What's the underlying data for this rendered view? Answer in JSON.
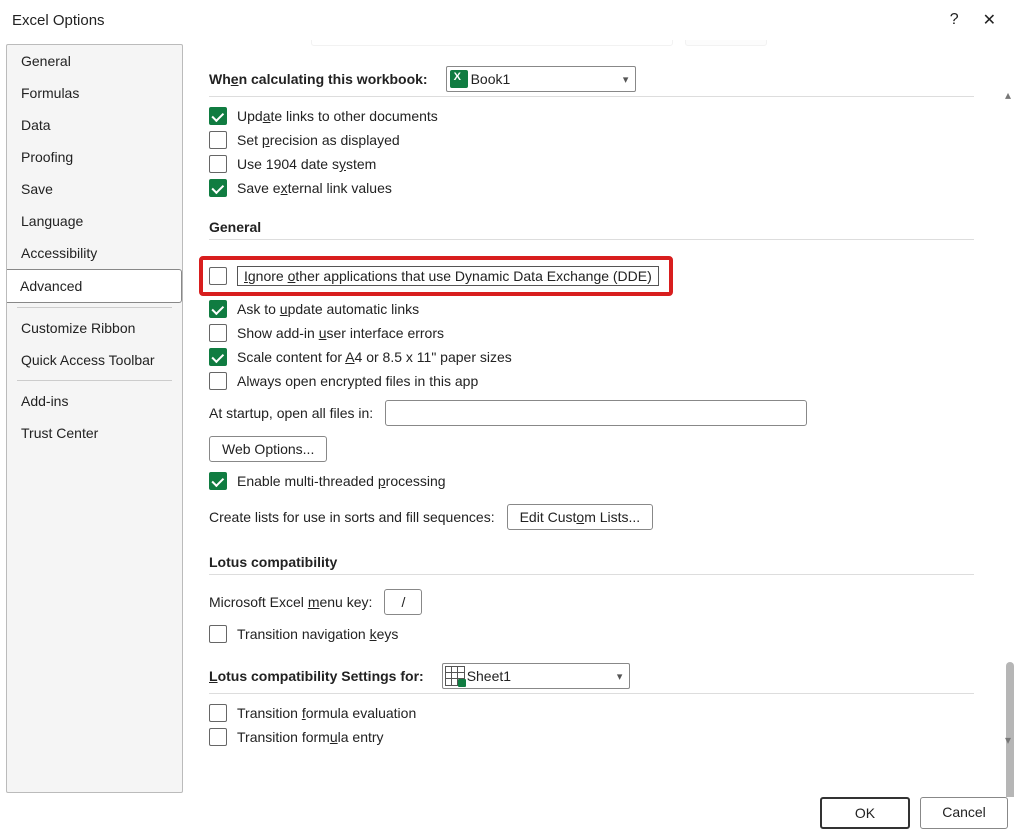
{
  "title": "Excel Options",
  "sidebar": {
    "items": [
      "General",
      "Formulas",
      "Data",
      "Proofing",
      "Save",
      "Language",
      "Accessibility",
      "Advanced",
      "Customize Ribbon",
      "Quick Access Toolbar",
      "Add-ins",
      "Trust Center"
    ],
    "selected_index": 7
  },
  "section_calc": {
    "label_html": "Wh<u>e</u>n calculating this workbook:",
    "workbook": "Book1",
    "opts": [
      {
        "checked": true,
        "label_html": "Upd<u>a</u>te links to other documents"
      },
      {
        "checked": false,
        "label_html": "Set <u>p</u>recision as displayed"
      },
      {
        "checked": false,
        "label_html": "Use 1904 date s<u>y</u>stem"
      },
      {
        "checked": true,
        "label_html": "Save e<u>x</u>ternal link values"
      }
    ]
  },
  "section_general": {
    "title": "General",
    "dde_label_html": "<u>I</u>gnore <u>o</u>ther applications that use Dynamic Data Exchange (DDE)",
    "dde_checked": false,
    "opts": [
      {
        "checked": true,
        "label_html": "Ask to <u>u</u>pdate automatic links"
      },
      {
        "checked": false,
        "label_html": "Show add-in <u>u</u>ser interface errors"
      },
      {
        "checked": true,
        "label_html": "Scale content for <u>A</u>4 or 8.5 x 11\" paper sizes"
      },
      {
        "checked": false,
        "label_html": "Always open encrypted files in this app"
      }
    ],
    "startup_label": "At startup, open all files in:",
    "startup_value": "",
    "web_options_btn": "Web Options...",
    "multi_thread": {
      "checked": true,
      "label_html": "Enable multi-threaded <u>p</u>rocessing"
    },
    "create_lists_label": "Create lists for use in sorts and fill sequences:",
    "edit_lists_btn_html": "Edit Cust<u>o</u>m Lists..."
  },
  "section_lotus": {
    "title": "Lotus compatibility",
    "menu_key_label_html": "Microsoft Excel <u>m</u>enu key:",
    "menu_key_value": "/",
    "nav_keys": {
      "checked": false,
      "label_html": "Transition navigation <u>k</u>eys"
    }
  },
  "section_lotus_for": {
    "title_html": "<u>L</u>otus compatibility Settings for:",
    "sheet": "Sheet1",
    "opts": [
      {
        "checked": false,
        "label_html": "Transition <u>f</u>ormula evaluation"
      },
      {
        "checked": false,
        "label_html": "Transition form<u>u</u>la entry"
      }
    ]
  },
  "footer": {
    "ok": "OK",
    "cancel": "Cancel"
  }
}
